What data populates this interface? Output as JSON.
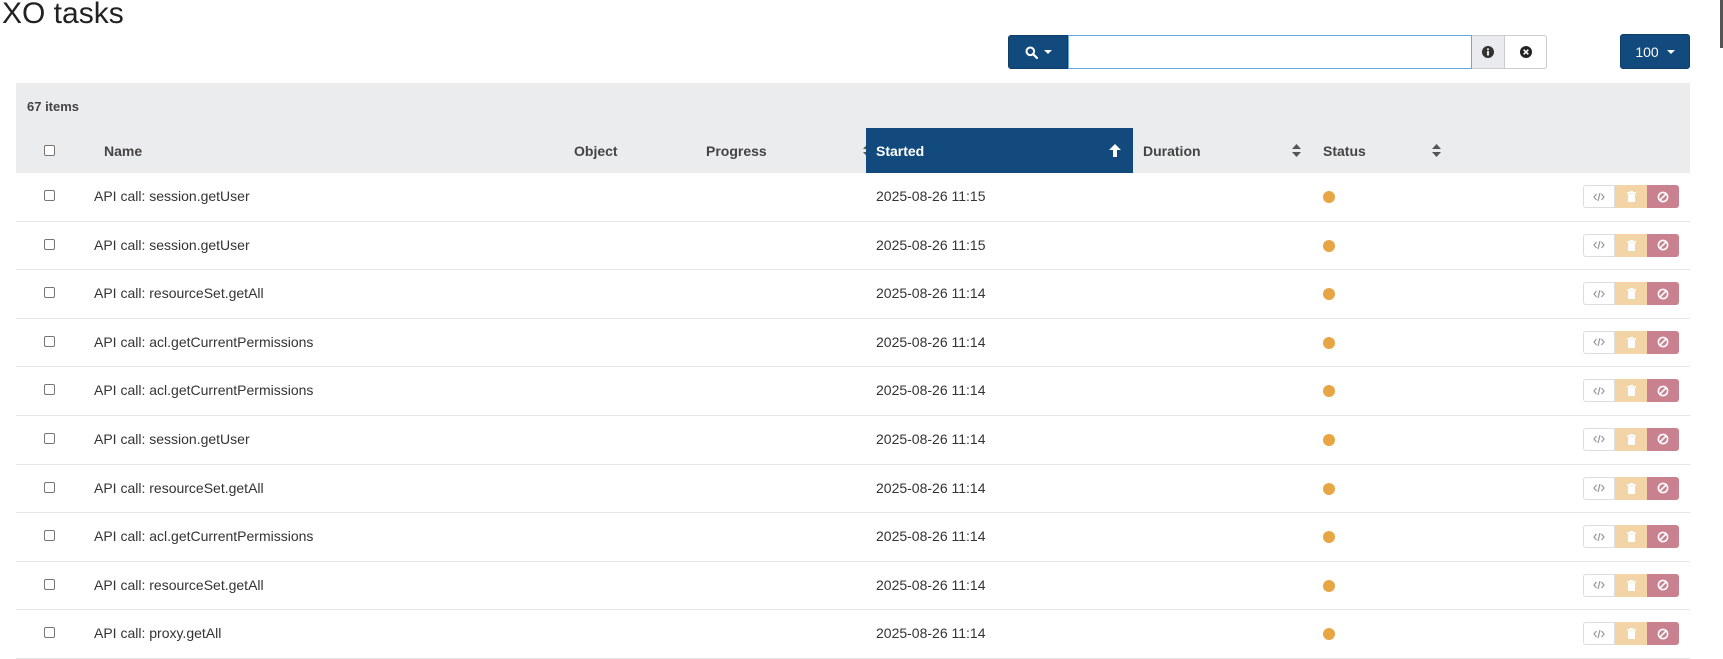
{
  "page": {
    "title": "XO tasks"
  },
  "search": {
    "value": "",
    "placeholder": ""
  },
  "pagination": {
    "page_size": "100"
  },
  "table": {
    "items_count": "67 items",
    "columns": {
      "name": "Name",
      "object": "Object",
      "progress": "Progress",
      "started": "Started",
      "duration": "Duration",
      "status": "Status"
    },
    "sort": {
      "column": "started",
      "direction": "ascending"
    },
    "rows": [
      {
        "name": "API call: session.getUser",
        "started": "2025-08-26 11:15",
        "status": "pending"
      },
      {
        "name": "API call: session.getUser",
        "started": "2025-08-26 11:15",
        "status": "pending"
      },
      {
        "name": "API call: resourceSet.getAll",
        "started": "2025-08-26 11:14",
        "status": "pending"
      },
      {
        "name": "API call: acl.getCurrentPermissions",
        "started": "2025-08-26 11:14",
        "status": "pending"
      },
      {
        "name": "API call: acl.getCurrentPermissions",
        "started": "2025-08-26 11:14",
        "status": "pending"
      },
      {
        "name": "API call: session.getUser",
        "started": "2025-08-26 11:14",
        "status": "pending"
      },
      {
        "name": "API call: resourceSet.getAll",
        "started": "2025-08-26 11:14",
        "status": "pending"
      },
      {
        "name": "API call: acl.getCurrentPermissions",
        "started": "2025-08-26 11:14",
        "status": "pending"
      },
      {
        "name": "API call: resourceSet.getAll",
        "started": "2025-08-26 11:14",
        "status": "pending"
      },
      {
        "name": "API call: proxy.getAll",
        "started": "2025-08-26 11:14",
        "status": "pending"
      }
    ],
    "row_actions": [
      "code-icon",
      "trash-icon",
      "ban-icon"
    ]
  },
  "colors": {
    "primary": "#124a7d",
    "status_pending": "#e8a544",
    "delete": "#f3d4a7",
    "cancel": "#c9818f",
    "header_bg": "#ebecee"
  }
}
